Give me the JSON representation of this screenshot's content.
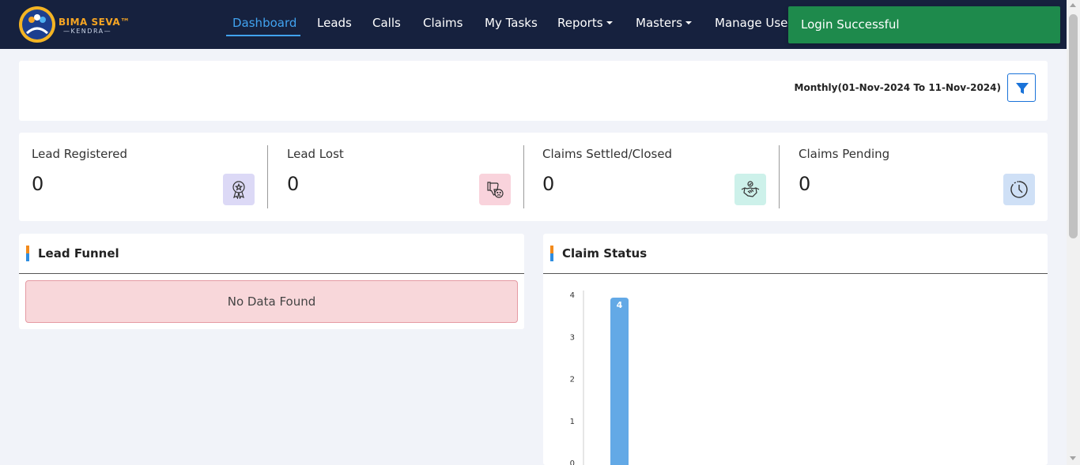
{
  "app": {
    "logo_title": "BIMA SEVA™",
    "logo_subtitle": "—KENDRA—"
  },
  "nav": {
    "items": [
      {
        "label": "Dashboard",
        "active": true
      },
      {
        "label": "Leads"
      },
      {
        "label": "Calls"
      },
      {
        "label": "Claims"
      },
      {
        "label": "My Tasks"
      },
      {
        "label": "Reports",
        "dropdown": true
      },
      {
        "label": "Masters",
        "dropdown": true
      },
      {
        "label": "Manage Users"
      }
    ]
  },
  "toast": {
    "message": "Login Successful",
    "color": "#1e8a4c"
  },
  "filter": {
    "period_label": "Monthly(01-Nov-2024 To 11-Nov-2024)",
    "icon": "filter-icon"
  },
  "stats": [
    {
      "label": "Lead Registered",
      "value": "0",
      "icon": "award-icon",
      "icon_bg": "#dcd9f6"
    },
    {
      "label": "Lead Lost",
      "value": "0",
      "icon": "thumbs-down-icon",
      "icon_bg": "#f9d3dc"
    },
    {
      "label": "Claims Settled/Closed",
      "value": "0",
      "icon": "handshake-icon",
      "icon_bg": "#cdf1ea"
    },
    {
      "label": "Claims Pending",
      "value": "0",
      "icon": "clock-icon",
      "icon_bg": "#cfe0f6"
    }
  ],
  "lead_funnel": {
    "title": "Lead Funnel",
    "empty_message": "No Data Found"
  },
  "claim_status": {
    "title": "Claim Status"
  },
  "chart_data": {
    "type": "bar",
    "categories": [
      ""
    ],
    "values": [
      4
    ],
    "data_labels": [
      "4"
    ],
    "yticks": [
      "0",
      "1",
      "2",
      "3",
      "4"
    ],
    "ylim": [
      0,
      4
    ],
    "color": "#63a9e6",
    "grid": false
  }
}
